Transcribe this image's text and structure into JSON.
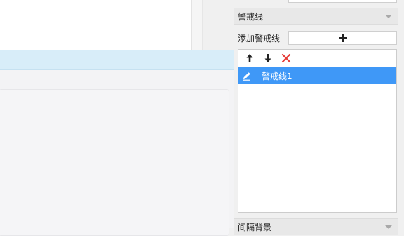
{
  "properties_panel": {
    "warning_line_section": {
      "title": "警戒线",
      "collapse_icon": "chevron-down-icon"
    },
    "add_row": {
      "label": "添加警戒线",
      "add_icon": "plus-icon"
    },
    "toolbar": {
      "move_up_icon": "arrow-up-icon",
      "move_down_icon": "arrow-down-icon",
      "delete_icon": "close-icon",
      "delete_color": "#e53935"
    },
    "items": [
      {
        "label": "警戒线1",
        "edit_icon": "pencil-icon"
      }
    ],
    "next_section": {
      "title": "间隔背景"
    }
  },
  "colors": {
    "selected_item": "#3f98f7",
    "selection_band": "#d8edf9"
  }
}
